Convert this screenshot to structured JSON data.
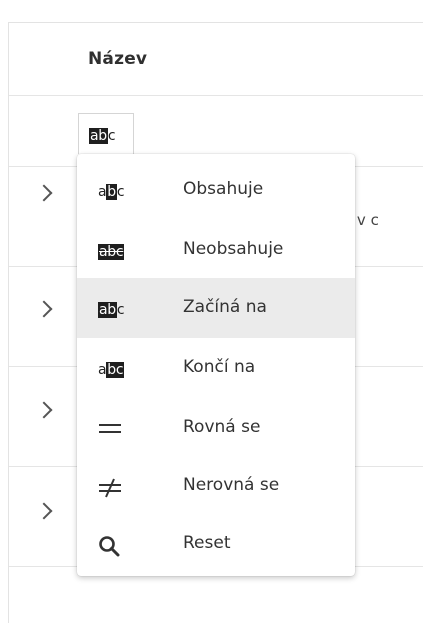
{
  "table": {
    "column_title": "Název",
    "truncated_cell_text": "í v c"
  },
  "filter": {
    "trigger_glyph": {
      "plain": "c",
      "highlighted": "ab"
    }
  },
  "menu": {
    "items": [
      {
        "label": "Obsahuje",
        "icon": "contains-icon",
        "glyph": {
          "before": "a",
          "hl": "b",
          "after": "c"
        }
      },
      {
        "label": "Neobsahuje",
        "icon": "not-contains-icon",
        "glyph": {
          "text": "abc"
        }
      },
      {
        "label": "Začíná na",
        "icon": "starts-with-icon",
        "glyph": {
          "before": "",
          "hl": "ab",
          "after": "c"
        },
        "active": true
      },
      {
        "label": "Končí na",
        "icon": "ends-with-icon",
        "glyph": {
          "before": "a",
          "hl": "bc",
          "after": ""
        }
      },
      {
        "label": "Rovná se",
        "icon": "equals-icon",
        "symbol": "="
      },
      {
        "label": "Nerovná se",
        "icon": "not-equals-icon",
        "symbol": "≠"
      },
      {
        "label": "Reset",
        "icon": "search-icon"
      }
    ]
  },
  "colors": {
    "active_item_bg": "#ebebeb",
    "highlight_bg": "#1f1f1f"
  }
}
